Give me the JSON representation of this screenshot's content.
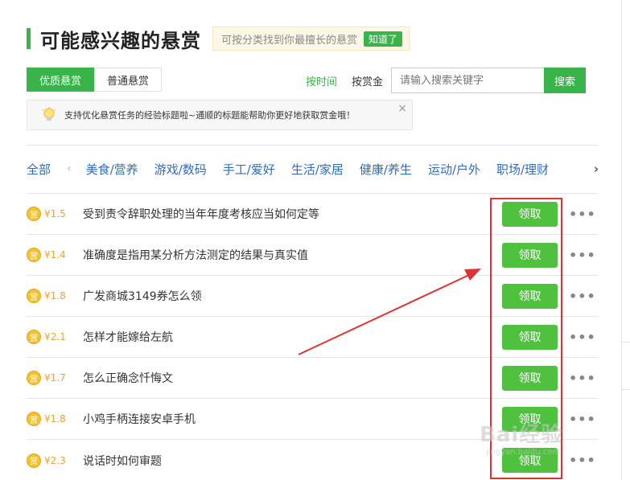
{
  "header": {
    "title": "可能感兴趣的悬赏",
    "tip_text": "可按分类找到你最擅长的悬赏",
    "tip_button": "知道了"
  },
  "tabs": [
    {
      "label": "优质悬赏",
      "active": true
    },
    {
      "label": "普通悬赏",
      "active": false
    }
  ],
  "sort": {
    "by_time": "按时间",
    "by_bounty": "按赏金"
  },
  "search": {
    "placeholder": "请输入搜索关键字",
    "button": "搜索"
  },
  "notice": {
    "text": "支持优化悬赏任务的经验标题啦~通顺的标题能帮助你更好地获取赏金哦！",
    "close": "×"
  },
  "categories": {
    "all": "全部",
    "prev": "‹",
    "next": "›",
    "items": [
      "美食/营养",
      "游戏/数码",
      "手工/爱好",
      "生活/家居",
      "健康/养生",
      "运动/户外",
      "职场/理财"
    ]
  },
  "list": {
    "coin_glyph": "赏",
    "claim_label": "领取",
    "more_label": "•••",
    "items": [
      {
        "reward": "¥1.5",
        "title": "受到责令辞职处理的当年年度考核应当如何定等"
      },
      {
        "reward": "¥1.4",
        "title": "准确度是指用某分析方法测定的结果与真实值"
      },
      {
        "reward": "¥1.8",
        "title": "广发商城3149券怎么领"
      },
      {
        "reward": "¥2.1",
        "title": "怎样才能嫁给左航"
      },
      {
        "reward": "¥1.7",
        "title": "怎么正确念忏悔文"
      },
      {
        "reward": "¥1.8",
        "title": "小鸡手柄连接安卓手机"
      },
      {
        "reward": "¥2.3",
        "title": "说话时如何审题"
      }
    ]
  },
  "watermark": {
    "main": "Bai经验",
    "sub": "jingyan.baidu.com"
  },
  "colors": {
    "brand_green": "#38b44a",
    "button_green": "#4fc13f",
    "link_blue": "#2f6db5",
    "reward_orange": "#e8a33b",
    "annotation_red": "#e03232"
  }
}
